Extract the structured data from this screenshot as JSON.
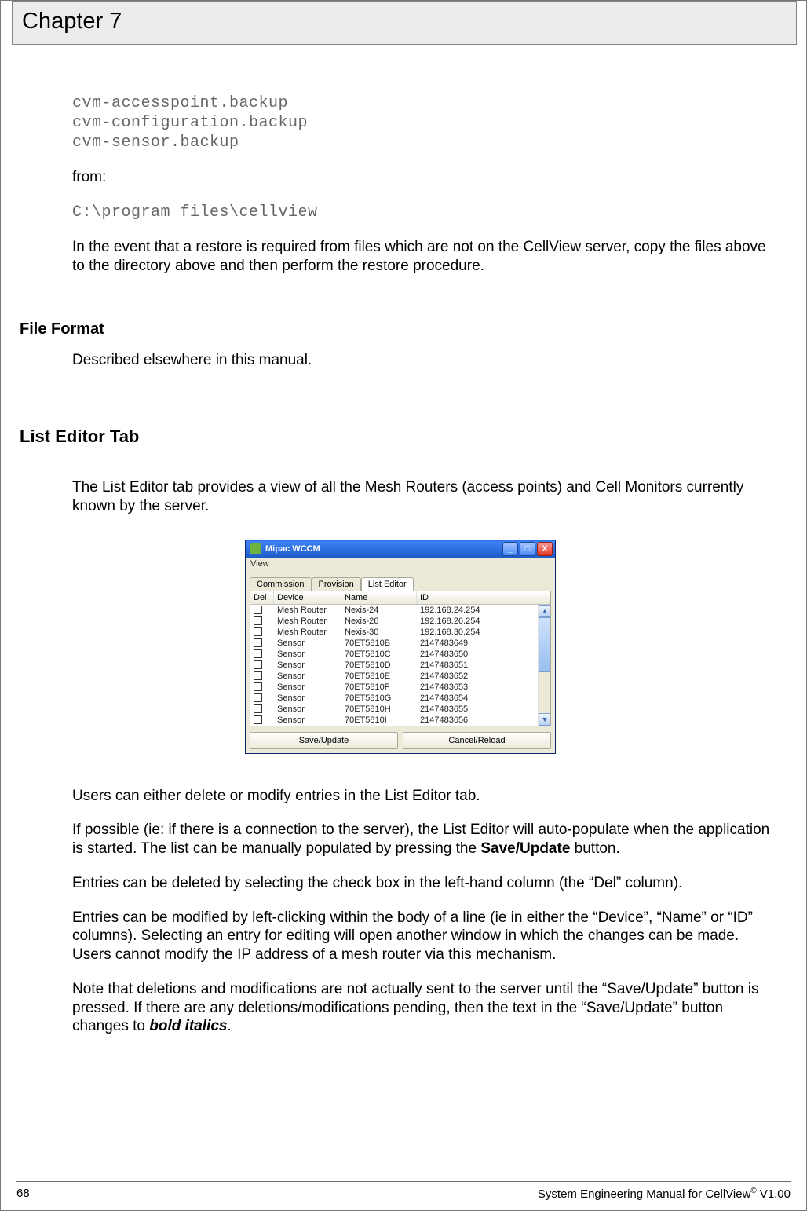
{
  "chapter_title": "Chapter 7",
  "code_block_1": {
    "line1": "cvm-accesspoint.backup",
    "line2": "cvm-configuration.backup",
    "line3": "cvm-sensor.backup"
  },
  "label_from": "from:",
  "code_block_2": "C:\\program files\\cellview",
  "paragraph_restore": "In the event that a restore is required from files which are not on the CellView server, copy the files above to the directory above and then perform the restore procedure.",
  "section_file_format": "File Format",
  "paragraph_file_format": "Described elsewhere in this manual.",
  "section_list_editor": "List Editor Tab",
  "paragraph_list_editor_intro": "The List Editor tab provides a view of all the Mesh Routers (access points) and Cell Monitors currently known by the server.",
  "window": {
    "title": "Mipac WCCM",
    "menu_view": "View",
    "tabs": {
      "commission": "Commission",
      "provision": "Provision",
      "list_editor": "List Editor"
    },
    "columns": {
      "del": "Del",
      "device": "Device",
      "name": "Name",
      "id": "ID"
    },
    "rows": [
      {
        "device": "Mesh Router",
        "name": "Nexis-24",
        "id": "192.168.24.254"
      },
      {
        "device": "Mesh Router",
        "name": "Nexis-26",
        "id": "192.168.26.254"
      },
      {
        "device": "Mesh Router",
        "name": "Nexis-30",
        "id": "192.168.30.254"
      },
      {
        "device": "Sensor",
        "name": "70ET5810B",
        "id": "2147483649"
      },
      {
        "device": "Sensor",
        "name": "70ET5810C",
        "id": "2147483650"
      },
      {
        "device": "Sensor",
        "name": "70ET5810D",
        "id": "2147483651"
      },
      {
        "device": "Sensor",
        "name": "70ET5810E",
        "id": "2147483652"
      },
      {
        "device": "Sensor",
        "name": "70ET5810F",
        "id": "2147483653"
      },
      {
        "device": "Sensor",
        "name": "70ET5810G",
        "id": "2147483654"
      },
      {
        "device": "Sensor",
        "name": "70ET5810H",
        "id": "2147483655"
      },
      {
        "device": "Sensor",
        "name": "70ET5810I",
        "id": "2147483656"
      }
    ],
    "button_save": "Save/Update",
    "button_cancel": "Cancel/Reload"
  },
  "paragraph_users": "Users can either delete or modify entries in the List Editor tab.",
  "paragraph_autopop_1": "If possible (ie: if there is a connection to the server), the List Editor will auto-populate when the application is started.  The list can be manually populated by pressing the ",
  "paragraph_autopop_bold": "Save/Update",
  "paragraph_autopop_2": " button.",
  "paragraph_delete": "Entries can be deleted by selecting the check box in the left-hand column (the “Del” column).",
  "paragraph_modify": "Entries can be modified by left-clicking within the body of a line (ie in either the “Device”, “Name” or “ID” columns).  Selecting an entry for editing will open another window in which the changes can be made.  Users cannot modify the IP address of a mesh router via this mechanism.",
  "paragraph_note_1": "Note that deletions and modifications are not actually sent to the server until the “Save/Update” button is pressed.  If there are any deletions/modifications pending, then the text in the “Save/Update” button changes to ",
  "paragraph_note_bold": "bold italics",
  "paragraph_note_2": ".",
  "footer": {
    "page_number": "68",
    "doc_title_1": "System Engineering Manual for CellView",
    "doc_title_sup": "©",
    "doc_title_2": " V1.00"
  }
}
